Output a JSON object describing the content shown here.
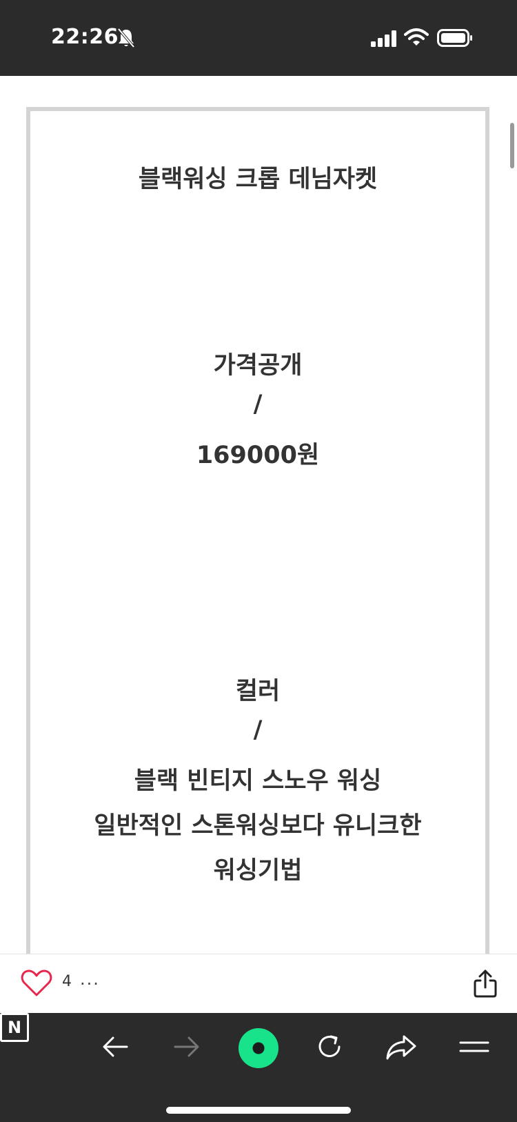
{
  "status_bar": {
    "time": "22:26"
  },
  "post": {
    "lines": [
      "블랙워싱 크롭 데님자켓",
      "가격공개",
      "/",
      "169000원",
      "컬러",
      "/",
      "블랙 빈티지 스노우 워싱",
      "일반적인 스톤워싱보다 유니크한",
      "워싱기법"
    ]
  },
  "actions": {
    "like_count": "4",
    "more": "..."
  },
  "toolbar": {
    "n_label": "N"
  },
  "colors": {
    "accent_green": "#19e38a",
    "heart_red": "#e8264c"
  },
  "icons": [
    "bell-off-icon",
    "signal-icon",
    "wifi-icon",
    "battery-icon",
    "heart-icon",
    "share-icon",
    "back-arrow-icon",
    "forward-arrow-icon",
    "reload-icon",
    "share-arrow-icon",
    "menu-icon"
  ]
}
